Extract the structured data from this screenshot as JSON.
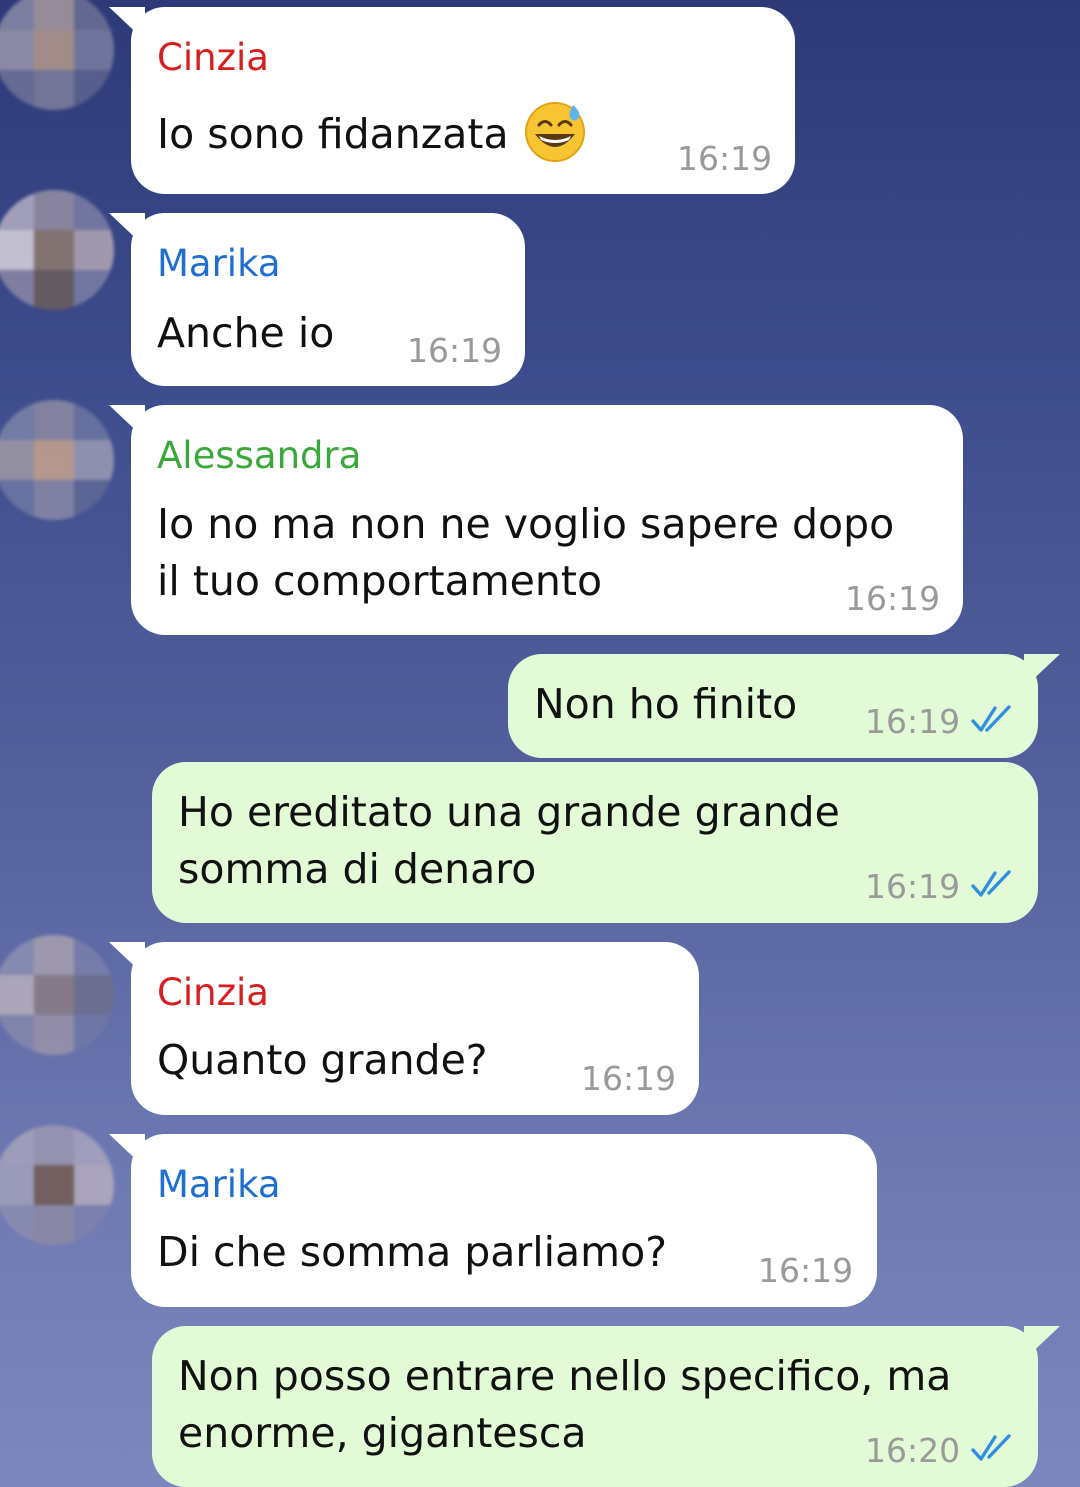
{
  "messages": [
    {
      "sender": "Cinzia",
      "text": "Io sono fidanzata",
      "emoji": "grinning-face-with-sweat-emoji",
      "time": "16:19"
    },
    {
      "sender": "Marika",
      "text": "Anche io",
      "time": "16:19"
    },
    {
      "sender": "Alessandra",
      "lines": [
        "Io no ma non ne voglio sapere dopo",
        "il tuo comportamento"
      ],
      "time": "16:19"
    },
    {
      "text": "Non ho finito",
      "time": "16:19"
    },
    {
      "lines": [
        "Ho ereditato una grande grande",
        "somma di denaro"
      ],
      "time": "16:19"
    },
    {
      "sender": "Cinzia",
      "text": "Quanto grande?",
      "time": "16:19"
    },
    {
      "sender": "Marika",
      "text": "Di che somma parliamo?",
      "time": "16:19"
    },
    {
      "lines": [
        "Non posso entrare nello specifico, ma",
        "enorme, gigantesca"
      ],
      "time": "16:20"
    }
  ],
  "colors": {
    "cinzia": "#d81e1e",
    "marika": "#1f6fd1",
    "alessandra": "#3aa83a",
    "incoming_bubble": "#ffffff",
    "outgoing_bubble": "#e2fbd6",
    "read_ticks": "#2f8fe0"
  }
}
